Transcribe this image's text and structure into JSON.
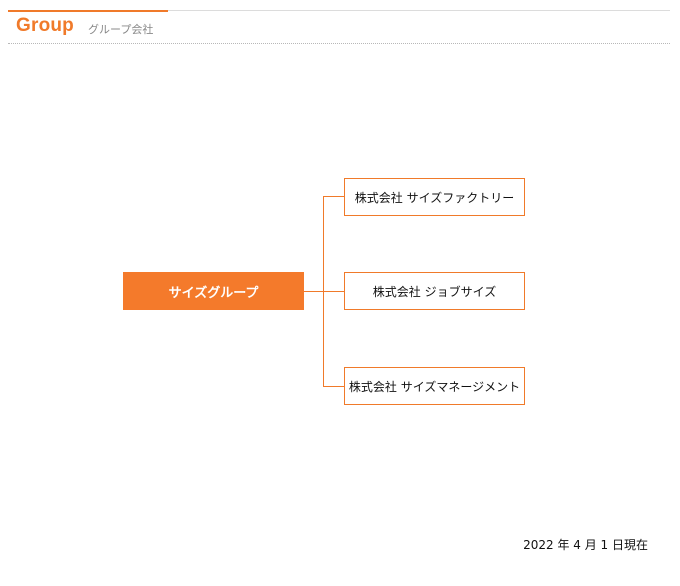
{
  "header": {
    "title": "Group",
    "subtitle": "グループ会社",
    "accent_color": "#f07a2a"
  },
  "org_chart": {
    "parent": {
      "label": "サイズグループ",
      "color": "#f47a2b"
    },
    "children": [
      {
        "label": "株式会社 サイズファクトリー"
      },
      {
        "label": "株式会社 ジョブサイズ"
      },
      {
        "label": "株式会社 サイズマネージメント"
      }
    ]
  },
  "footer": {
    "as_of": "2022 年 4 月 1 日現在"
  }
}
